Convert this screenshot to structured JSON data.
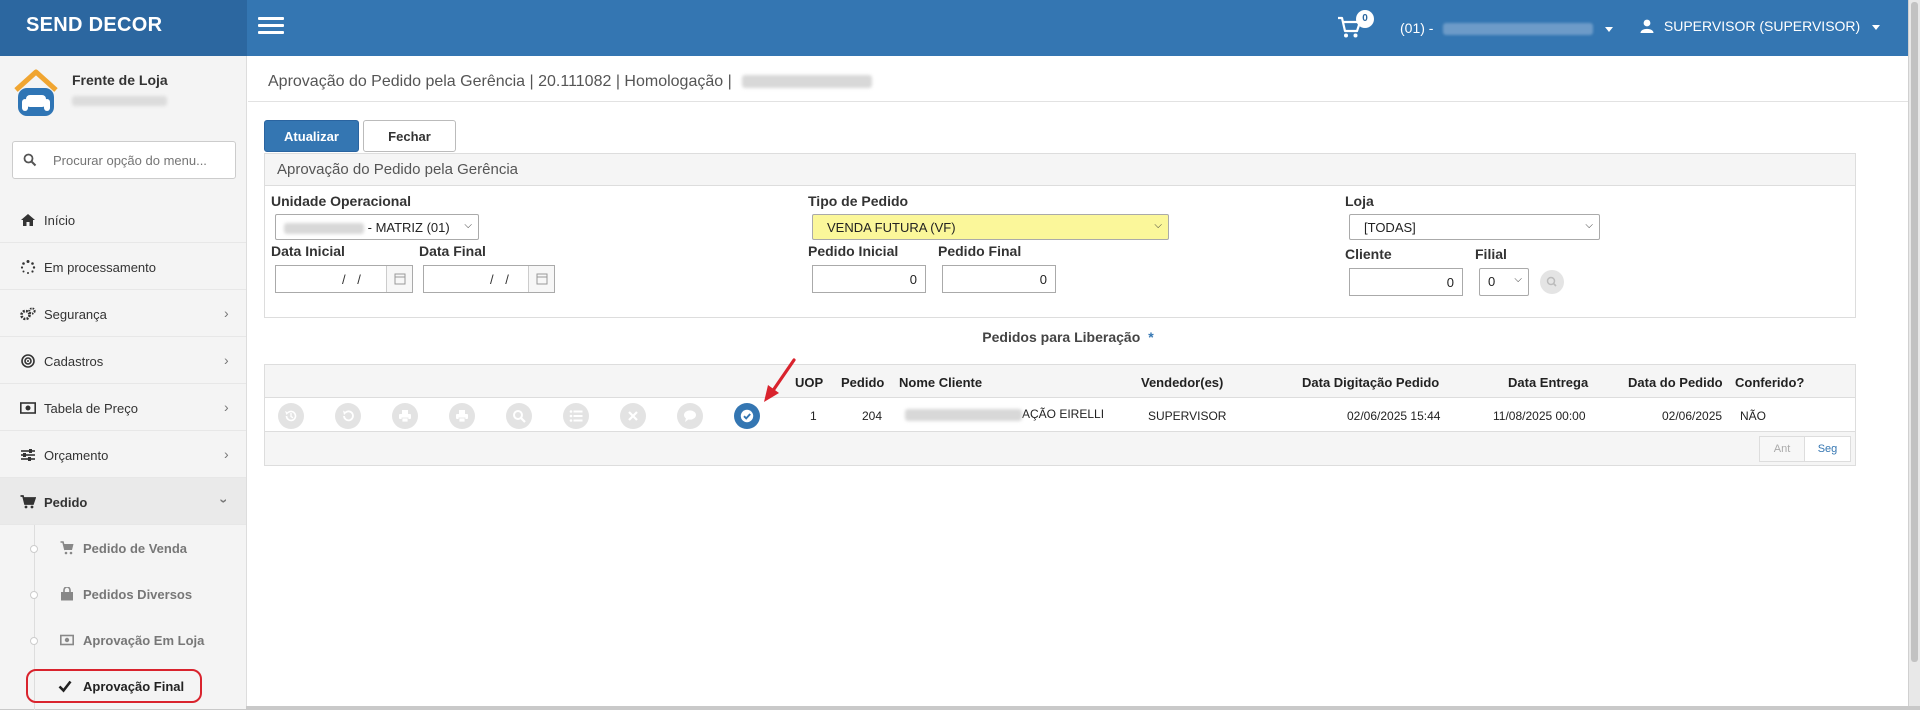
{
  "app": {
    "brand": "SEND DECOR",
    "cart_count": "0",
    "unit_selector_prefix": "(01) -",
    "user_label": "SUPERVISOR (SUPERVISOR)"
  },
  "sidebar": {
    "profile_title": "Frente de Loja",
    "search_placeholder": "Procurar opção do menu...",
    "items": [
      {
        "label": "Início",
        "icon": "home-icon"
      },
      {
        "label": "Em processamento",
        "icon": "spinner-icon"
      },
      {
        "label": "Segurança",
        "icon": "cogs-icon"
      },
      {
        "label": "Cadastros",
        "icon": "target-icon"
      },
      {
        "label": "Tabela de Preço",
        "icon": "money-icon"
      },
      {
        "label": "Orçamento",
        "icon": "sliders-icon"
      },
      {
        "label": "Pedido",
        "icon": "cart-icon"
      }
    ],
    "subitems": [
      {
        "label": "Pedido de Venda",
        "icon": "cart-icon"
      },
      {
        "label": "Pedidos Diversos",
        "icon": "shopping-bag-icon"
      },
      {
        "label": "Aprovação Em Loja",
        "icon": "money-icon"
      },
      {
        "label": "Aprovação Final",
        "icon": "check-icon"
      }
    ]
  },
  "page": {
    "title": "Aprovação do Pedido pela Gerência | 20.111082 | Homologação |",
    "buttons": {
      "refresh": "Atualizar",
      "close": "Fechar"
    },
    "panel_title": "Aprovação do Pedido pela Gerência"
  },
  "filters": {
    "unidade_label": "Unidade Operacional",
    "unidade_value": "- MATRIZ (01)",
    "tipo_label": "Tipo de Pedido",
    "tipo_value": "VENDA FUTURA (VF)",
    "loja_label": "Loja",
    "loja_value": "[TODAS]",
    "data_inicial_label": "Data Inicial",
    "data_inicial_value": "/ /",
    "data_final_label": "Data Final",
    "data_final_value": "/ /",
    "pedido_inicial_label": "Pedido Inicial",
    "pedido_inicial_value": "0",
    "pedido_final_label": "Pedido Final",
    "pedido_final_value": "0",
    "cliente_label": "Cliente",
    "cliente_value": "0",
    "filial_label": "Filial",
    "filial_value": "0"
  },
  "grid": {
    "section_title": "Pedidos para Liberação",
    "required_marker": "*",
    "columns": [
      "UOP",
      "Pedido",
      "Nome Cliente",
      "Vendedor(es)",
      "Data Digitação Pedido",
      "Data Entrega",
      "Data do Pedido",
      "Conferido?"
    ],
    "rows": [
      {
        "uop": "1",
        "pedido": "204",
        "cliente_suffix": "AÇÃO EIRELLI",
        "vendedor": "SUPERVISOR",
        "data_digitacao": "02/06/2025 15:44",
        "data_entrega": "11/08/2025 00:00",
        "data_pedido": "02/06/2025",
        "conferido": "NÃO"
      }
    ],
    "row_actions": [
      "history-icon",
      "undo-icon",
      "print-icon",
      "print-icon",
      "search-icon",
      "list-icon",
      "cancel-icon",
      "comment-icon",
      "approve-check-icon"
    ],
    "pager": {
      "prev": "Ant",
      "next": "Seg"
    }
  }
}
